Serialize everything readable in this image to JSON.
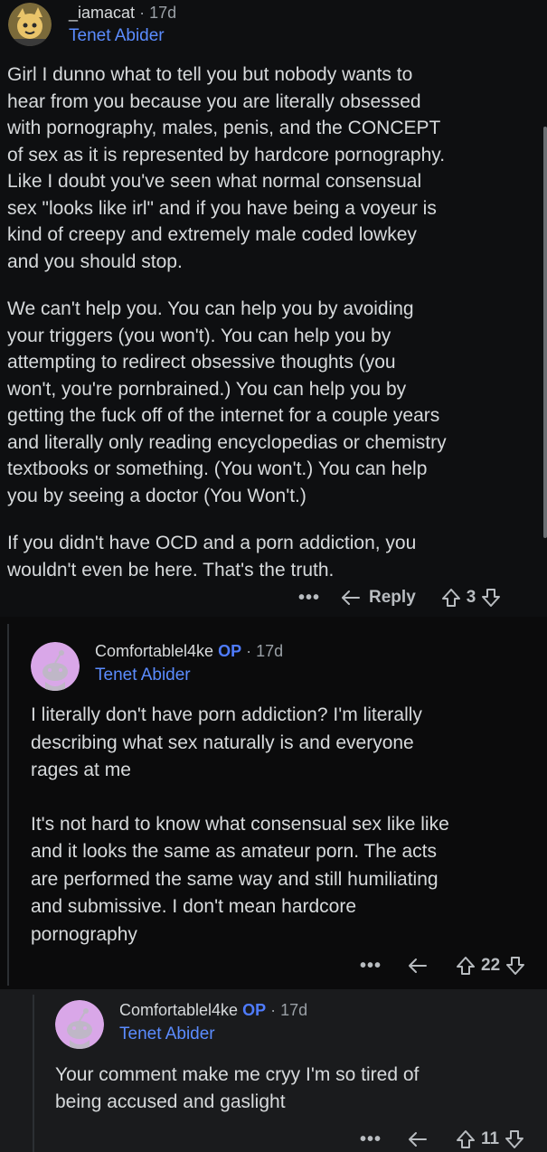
{
  "comments": [
    {
      "username": "_iamacat",
      "op_badge": "",
      "separator": "·",
      "age": "17d",
      "flair": "Tenet Abider",
      "paragraphs": [
        [
          "Girl I dunno what to tell you but nobody wants to",
          "hear from you because you are literally obsessed",
          "with pornography, males, penis, and the CONCEPT",
          "of sex as it is represented by hardcore pornography.",
          "Like I doubt you've seen what normal consensual",
          "sex \"looks like irl\" and if you have being a voyeur is",
          "kind of creepy and extremely male coded lowkey",
          "and you should stop."
        ],
        [
          "We can't help you. You can help you by avoiding",
          "your triggers (you won't). You can help you by",
          "attempting to redirect obsessive thoughts (you",
          "won't, you're pornbrained.) You can help you by",
          "getting the fuck off of the internet for a couple years",
          "and literally only reading encyclopedias or chemistry",
          "textbooks or something. (You won't.) You can help",
          "you by seeing a doctor (You Won't.)"
        ],
        [
          "If you didn't have OCD and a porn addiction, you",
          "wouldn't even be here. That's the truth."
        ]
      ],
      "actions": {
        "more": "•••",
        "reply": "Reply",
        "votes": "3"
      }
    },
    {
      "username": "Comfortablel4ke",
      "op_badge": "OP",
      "separator": "·",
      "age": "17d",
      "flair": "Tenet Abider",
      "paragraphs": [
        [
          "I literally don't have porn addiction? I'm literally",
          "describing what sex naturally is and everyone",
          "rages at me"
        ],
        [
          "It's not hard to know what consensual sex like like",
          "and it looks the same as amateur porn. The acts",
          "are performed the same way and still humiliating",
          "and submissive. I don't mean hardcore",
          "pornography"
        ]
      ],
      "actions": {
        "more": "•••",
        "reply": "",
        "votes": "22"
      }
    },
    {
      "username": "Comfortablel4ke",
      "op_badge": "OP",
      "separator": "·",
      "age": "17d",
      "flair": "Tenet Abider",
      "paragraphs": [
        [
          "Your comment make me cryy I'm so tired of",
          "being accused and gaslight"
        ]
      ],
      "actions": {
        "more": "•••",
        "reply": "",
        "votes": "11"
      }
    }
  ],
  "colors": {
    "background": "#0e0f11",
    "text": "#d7dadc",
    "flair": "#5b8cff",
    "op": "#4f7cff",
    "meta": "#9aa0a6",
    "avatar_pink": "#d9a7e8"
  }
}
